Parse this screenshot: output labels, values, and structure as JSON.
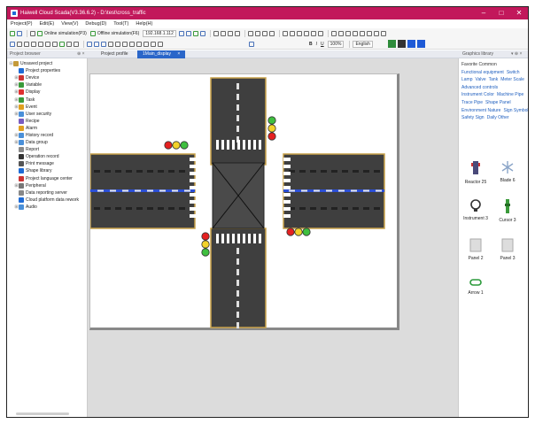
{
  "window": {
    "title": "Haiwell Cloud Scada(V3.36.6.2) - D:\\test\\cross_traffic",
    "min": "–",
    "max": "□",
    "close": "✕"
  },
  "menu": [
    "Project(P)",
    "Edit(E)",
    "View(V)",
    "Debug(D)",
    "Tool(T)",
    "Help(H)"
  ],
  "toolbar1": {
    "online": "Online simulation(P3)",
    "offline": "Offline simulation(F6)",
    "ip": "192.168.1.112"
  },
  "toolbar2": {
    "zoom": "100%",
    "lang": "English"
  },
  "left_panel": {
    "title": "Project browser",
    "pin": "⊕ ×",
    "tree": [
      {
        "label": "Unsaved project",
        "level": 0,
        "twist": "⊟",
        "color": "#c49a3a"
      },
      {
        "label": "Project properties",
        "level": 1,
        "twist": "",
        "color": "#1e6bd6"
      },
      {
        "label": "Device",
        "level": 1,
        "twist": "⊞",
        "color": "#c33"
      },
      {
        "label": "Variable",
        "level": 1,
        "twist": "⊞",
        "color": "#3a9a3a"
      },
      {
        "label": "Display",
        "level": 1,
        "twist": "⊞",
        "color": "#e03030"
      },
      {
        "label": "Task",
        "level": 1,
        "twist": "⊞",
        "color": "#3a9a3a"
      },
      {
        "label": "Event",
        "level": 1,
        "twist": "⊞",
        "color": "#e0a020"
      },
      {
        "label": "User security",
        "level": 1,
        "twist": "⊞",
        "color": "#4a90d9"
      },
      {
        "label": "Recipe",
        "level": 1,
        "twist": "",
        "color": "#7a5cc0"
      },
      {
        "label": "Alarm",
        "level": 1,
        "twist": "",
        "color": "#e0a020"
      },
      {
        "label": "History record",
        "level": 1,
        "twist": "⊞",
        "color": "#4a90d9"
      },
      {
        "label": "Data group",
        "level": 1,
        "twist": "⊞",
        "color": "#4a90d9"
      },
      {
        "label": "Report",
        "level": 1,
        "twist": "",
        "color": "#888"
      },
      {
        "label": "Operation record",
        "level": 1,
        "twist": "",
        "color": "#333"
      },
      {
        "label": "Print message",
        "level": 1,
        "twist": "",
        "color": "#555"
      },
      {
        "label": "Shape library",
        "level": 1,
        "twist": "",
        "color": "#1e6bd6"
      },
      {
        "label": "Project language center",
        "level": 1,
        "twist": "",
        "color": "#c33"
      },
      {
        "label": "Peripheral",
        "level": 1,
        "twist": "⊞",
        "color": "#777"
      },
      {
        "label": "Data reporting server",
        "level": 1,
        "twist": "",
        "color": "#888"
      },
      {
        "label": "Cloud platform data rework",
        "level": 1,
        "twist": "",
        "color": "#1e6bd6"
      },
      {
        "label": "Audio",
        "level": 1,
        "twist": "⊞",
        "color": "#4a90d9"
      }
    ]
  },
  "tabs": {
    "profile": "Project profile",
    "display": "1Main_display",
    "close": "×"
  },
  "right_panel": {
    "title": "Graphics library",
    "pin": "▾ ⊕ ×",
    "categories": [
      "Favorite Common",
      "Functional equipment",
      "Switch",
      "Lamp",
      "Valve",
      "Tank",
      "Meter Scale",
      "Advanced controls",
      "Instrument Color",
      "Machine Pipe",
      "Trace Pipe",
      "Shape Panel",
      "Environment Nature",
      "Sign Symbol",
      "Safety Sign",
      "Daily Other"
    ],
    "items": [
      {
        "label": "Reactor 25",
        "icon": "reactor-icon"
      },
      {
        "label": "Blade 6",
        "icon": "snowflake-icon"
      },
      {
        "label": "Instrument 3",
        "icon": "gauge-icon"
      },
      {
        "label": "Cursor 3",
        "icon": "cursor-icon"
      },
      {
        "label": "Panel 2",
        "icon": "panel-icon"
      },
      {
        "label": "Panel 3",
        "icon": "panel-icon"
      },
      {
        "label": "Arrow 1",
        "icon": "arrow-icon"
      }
    ]
  },
  "colors": {
    "titlebar": "#c2185b",
    "road": "#3f3f3f",
    "road_edge": "#c8a24a",
    "lane_blue": "#2b4fd6",
    "light_red": "#e52020",
    "light_yellow": "#f2d22a",
    "light_green": "#3fbf3f",
    "active_tab": "#2a66c9"
  }
}
